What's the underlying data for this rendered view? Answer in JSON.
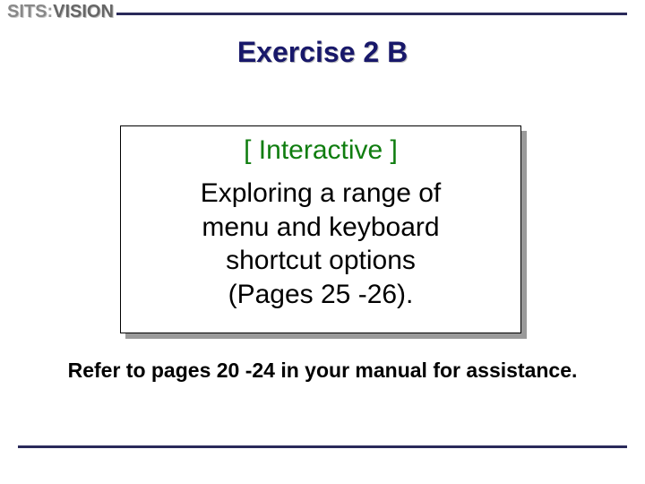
{
  "logo": {
    "part1": "SITS",
    "sep": ":",
    "part2": "VISION"
  },
  "title": "Exercise 2 B",
  "box": {
    "heading": "[ Interactive ]",
    "body_line1": "Exploring a range of",
    "body_line2": "menu and keyboard",
    "body_line3": "shortcut options",
    "body_line4": "(Pages 25 -26)."
  },
  "footer": "Refer to pages 20 -24 in your manual for assistance."
}
